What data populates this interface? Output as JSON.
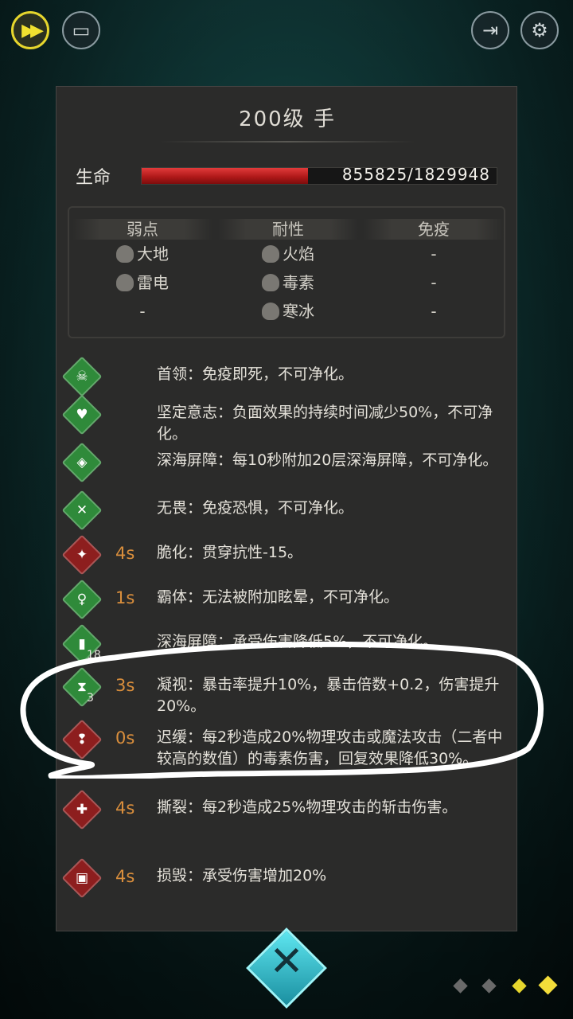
{
  "top_bar": {
    "speed_glyph": "▶▶",
    "screen_glyph": "▭",
    "exit_glyph": "⇥",
    "gear_glyph": "⚙"
  },
  "panel": {
    "title": "200级 手",
    "hp_label": "生命",
    "hp_current": 855825,
    "hp_max": 1829948,
    "hp_text": "855825/1829948"
  },
  "resistances": {
    "columns": [
      {
        "header": "弱点",
        "items": [
          "大地",
          "雷电",
          "-"
        ]
      },
      {
        "header": "耐性",
        "items": [
          "火焰",
          "毒素",
          "寒冰"
        ]
      },
      {
        "header": "免疫",
        "items": [
          "-",
          "-",
          "-"
        ]
      }
    ]
  },
  "effects": [
    {
      "color": "green",
      "icon": "skull-icon",
      "glyph": "☠",
      "stack": "",
      "duration": "",
      "text": "首领：免疫即死，不可净化。"
    },
    {
      "color": "green",
      "icon": "heart-shield-icon",
      "glyph": "♥",
      "stack": "",
      "duration": "",
      "text": "坚定意志：负面效果的持续时间减少50%，不可净化。"
    },
    {
      "color": "green",
      "icon": "shield-icon",
      "glyph": "◈",
      "stack": "",
      "duration": "",
      "text": "深海屏障：每10秒附加20层深海屏障，不可净化。"
    },
    {
      "color": "green",
      "icon": "crossed-swords-icon",
      "glyph": "✕",
      "stack": "",
      "duration": "",
      "text": "无畏：免疫恐惧，不可净化。"
    },
    {
      "color": "red",
      "icon": "broken-armor-icon",
      "glyph": "✦",
      "stack": "",
      "duration": "4s",
      "text": "脆化：贯穿抗性-15。"
    },
    {
      "color": "green",
      "icon": "figure-icon",
      "glyph": "♀",
      "stack": "",
      "duration": "1s",
      "text": "霸体：无法被附加眩晕，不可净化。"
    },
    {
      "color": "green",
      "icon": "barrier-icon",
      "glyph": "▮",
      "stack": "18",
      "duration": "",
      "text": "深海屏障：承受伤害降低5%，不可净化。"
    },
    {
      "color": "green",
      "icon": "hourglass-icon",
      "glyph": "⧗",
      "stack": "3",
      "duration": "3s",
      "text": "凝视：暴击率提升10%，暴击倍数+0.2，伤害提升20%。"
    },
    {
      "color": "red",
      "icon": "poison-drops-icon",
      "glyph": "❢",
      "stack": "",
      "duration": "0s",
      "text": "迟缓：每2秒造成20%物理攻击或魔法攻击（二者中较高的数值）的毒素伤害，回复效果降低30%。"
    },
    {
      "color": "red",
      "icon": "cross-icon",
      "glyph": "✚",
      "stack": "",
      "duration": "4s",
      "text": "撕裂：每2秒造成25%物理攻击的斩击伤害。"
    },
    {
      "color": "red",
      "icon": "damage-up-icon",
      "glyph": "▣",
      "stack": "",
      "duration": "4s",
      "text": "损毁：承受伤害增加20%"
    }
  ],
  "close_glyph": "✕",
  "colors": {
    "gold": "#e6d62d",
    "buff_green": "#2f8a3a",
    "debuff_red": "#8d1e1e",
    "duration_orange": "#d98e3c",
    "hp_red": "#c62222"
  }
}
